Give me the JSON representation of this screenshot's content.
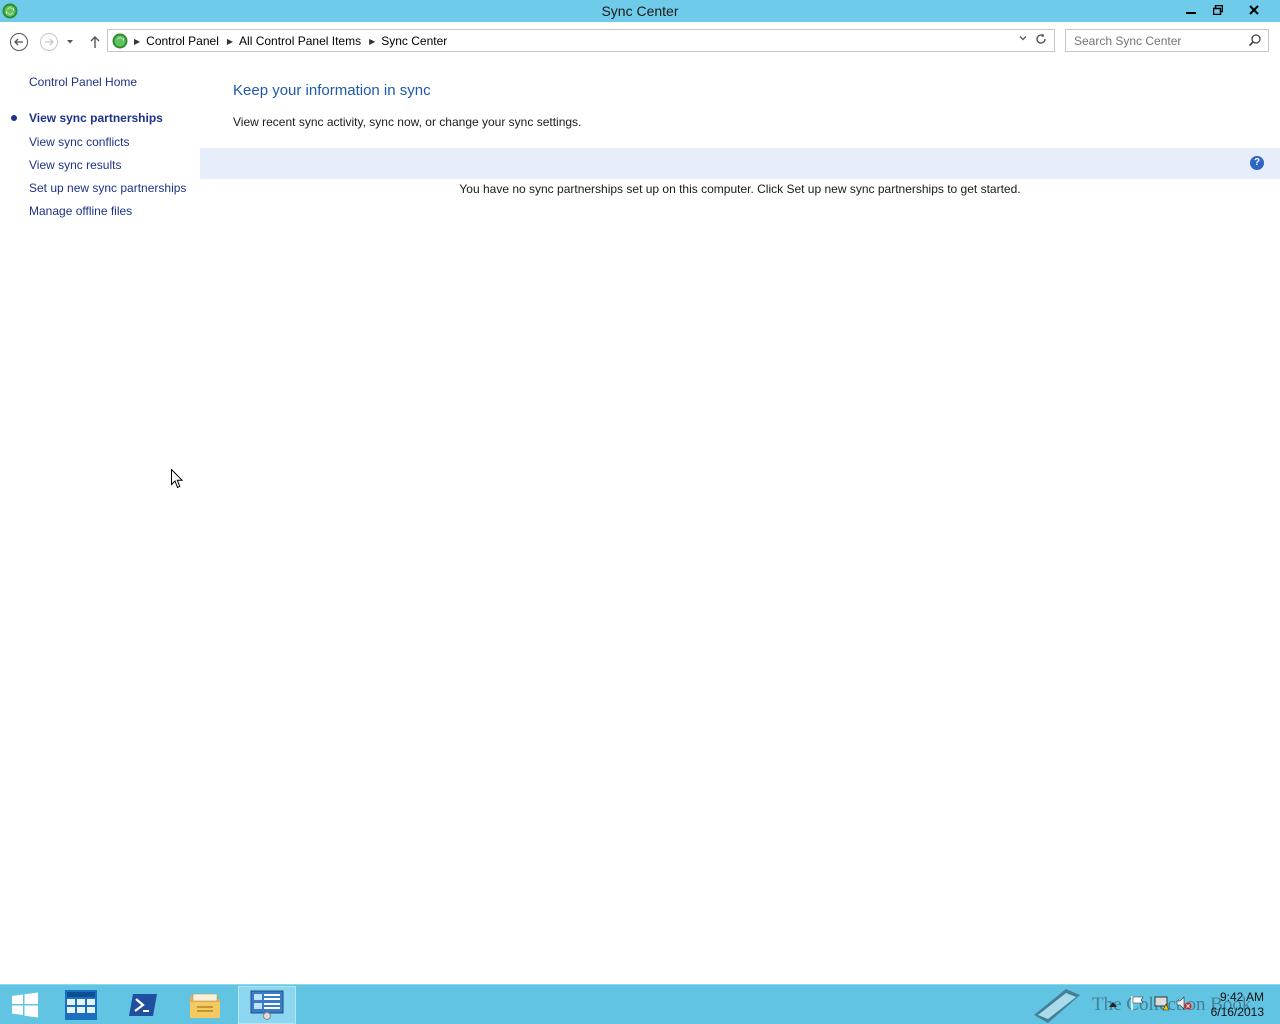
{
  "window": {
    "title": "Sync Center",
    "controls": {
      "minimize": "minimize-icon",
      "maximize": "restore-icon",
      "close": "close-icon"
    }
  },
  "navigation": {
    "back": "back-arrow-icon",
    "forward": "forward-arrow-icon",
    "recent": "chevron-down-icon",
    "up": "up-arrow-icon",
    "breadcrumb": [
      "Control Panel",
      "All Control Panel Items",
      "Sync Center"
    ],
    "search_placeholder": "Search Sync Center"
  },
  "sidebar": {
    "home": "Control Panel Home",
    "items": [
      {
        "label": "View sync partnerships",
        "active": true
      },
      {
        "label": "View sync conflicts",
        "active": false
      },
      {
        "label": "View sync results",
        "active": false
      },
      {
        "label": "Set up new sync partnerships",
        "active": false
      },
      {
        "label": "Manage offline files",
        "active": false
      }
    ]
  },
  "main": {
    "heading": "Keep your information in sync",
    "subtext": "View recent sync activity, sync now, or change your sync settings.",
    "empty_message": "You have no sync partnerships set up on this computer. Click Set up new sync partnerships to get started.",
    "help": "?"
  },
  "taskbar": {
    "buttons": [
      "start",
      "server-manager",
      "powershell",
      "file-explorer",
      "control-panel"
    ],
    "time": "9:42 AM",
    "date": "6/16/2013",
    "watermark": "The Collection Book"
  },
  "colors": {
    "titlebar": "#6fcbea",
    "link": "#1e3287",
    "heading": "#1e5aa8",
    "infobar": "#e7eefb",
    "taskbar": "#62c4e3"
  }
}
